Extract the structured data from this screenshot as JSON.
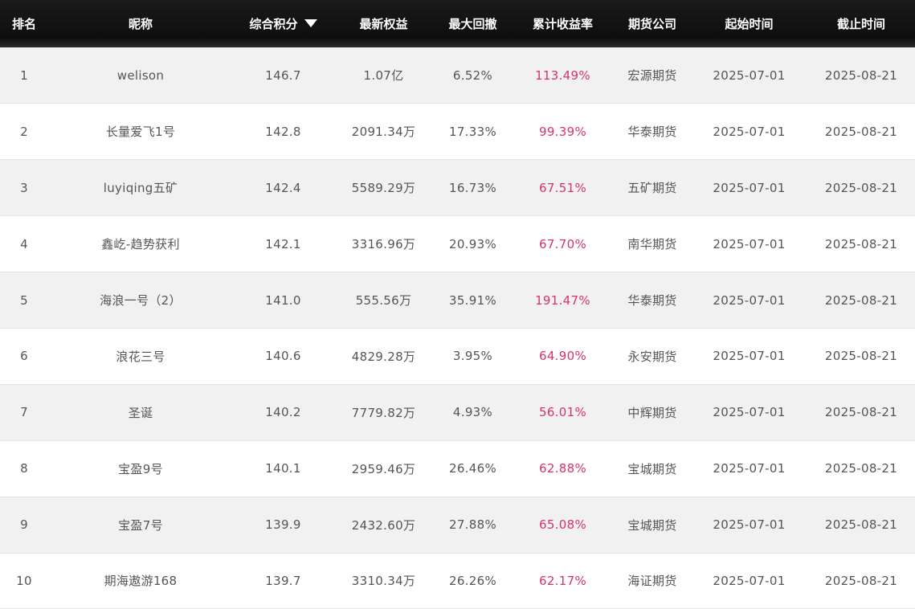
{
  "header": {
    "rank": "排名",
    "nickname": "昵称",
    "score": "综合积分",
    "equity": "最新权益",
    "drawdown": "最大回撤",
    "return": "累计收益率",
    "company": "期货公司",
    "start": "起始时间",
    "end": "截止时间"
  },
  "sort_icon": "caret-down-icon",
  "colors": {
    "header_bg": "#111111",
    "return_text": "#d6336c",
    "odd_row": "#f1f1f1"
  },
  "rows": [
    {
      "rank": "1",
      "nickname": "welison",
      "score": "146.7",
      "equity": "1.07亿",
      "drawdown": "6.52%",
      "return": "113.49%",
      "company": "宏源期货",
      "start": "2025-07-01",
      "end": "2025-08-21"
    },
    {
      "rank": "2",
      "nickname": "长量爱飞1号",
      "score": "142.8",
      "equity": "2091.34万",
      "drawdown": "17.33%",
      "return": "99.39%",
      "company": "华泰期货",
      "start": "2025-07-01",
      "end": "2025-08-21"
    },
    {
      "rank": "3",
      "nickname": "luyiqing五矿",
      "score": "142.4",
      "equity": "5589.29万",
      "drawdown": "16.73%",
      "return": "67.51%",
      "company": "五矿期货",
      "start": "2025-07-01",
      "end": "2025-08-21"
    },
    {
      "rank": "4",
      "nickname": "鑫屹-趋势获利",
      "score": "142.1",
      "equity": "3316.96万",
      "drawdown": "20.93%",
      "return": "67.70%",
      "company": "南华期货",
      "start": "2025-07-01",
      "end": "2025-08-21"
    },
    {
      "rank": "5",
      "nickname": "海浪一号（2）",
      "score": "141.0",
      "equity": "555.56万",
      "drawdown": "35.91%",
      "return": "191.47%",
      "company": "华泰期货",
      "start": "2025-07-01",
      "end": "2025-08-21"
    },
    {
      "rank": "6",
      "nickname": "浪花三号",
      "score": "140.6",
      "equity": "4829.28万",
      "drawdown": "3.95%",
      "return": "64.90%",
      "company": "永安期货",
      "start": "2025-07-01",
      "end": "2025-08-21"
    },
    {
      "rank": "7",
      "nickname": "圣诞",
      "score": "140.2",
      "equity": "7779.82万",
      "drawdown": "4.93%",
      "return": "56.01%",
      "company": "中辉期货",
      "start": "2025-07-01",
      "end": "2025-08-21"
    },
    {
      "rank": "8",
      "nickname": "宝盈9号",
      "score": "140.1",
      "equity": "2959.46万",
      "drawdown": "26.46%",
      "return": "62.88%",
      "company": "宝城期货",
      "start": "2025-07-01",
      "end": "2025-08-21"
    },
    {
      "rank": "9",
      "nickname": "宝盈7号",
      "score": "139.9",
      "equity": "2432.60万",
      "drawdown": "27.88%",
      "return": "65.08%",
      "company": "宝城期货",
      "start": "2025-07-01",
      "end": "2025-08-21"
    },
    {
      "rank": "10",
      "nickname": "期海遨游168",
      "score": "139.7",
      "equity": "3310.34万",
      "drawdown": "26.26%",
      "return": "62.17%",
      "company": "海证期货",
      "start": "2025-07-01",
      "end": "2025-08-21"
    }
  ]
}
